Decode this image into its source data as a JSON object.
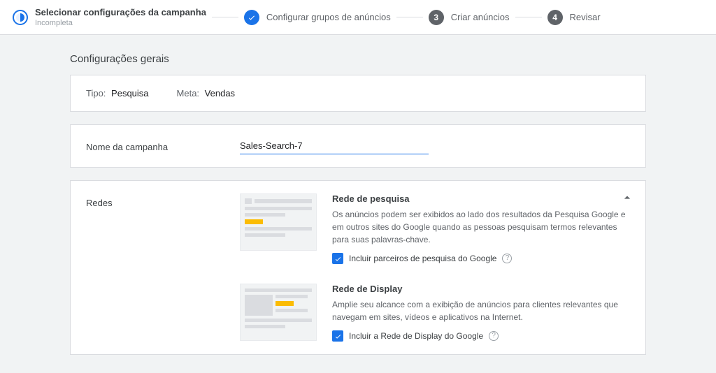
{
  "stepper": {
    "step1": {
      "title": "Selecionar configurações da campanha",
      "sub": "Incompleta"
    },
    "step2": {
      "title": "Configurar grupos de anúncios"
    },
    "step3": {
      "num": "3",
      "title": "Criar anúncios"
    },
    "step4": {
      "num": "4",
      "title": "Revisar"
    }
  },
  "page_title": "Configurações gerais",
  "summary": {
    "type_label": "Tipo:",
    "type_value": "Pesquisa",
    "goal_label": "Meta:",
    "goal_value": "Vendas"
  },
  "campaign_name": {
    "label": "Nome da campanha",
    "value": "Sales-Search-7"
  },
  "networks": {
    "section_label": "Redes",
    "search": {
      "title": "Rede de pesquisa",
      "desc": "Os anúncios podem ser exibidos ao lado dos resultados da Pesquisa Google e em outros sites do Google quando as pessoas pesquisam termos relevantes para suas palavras-chave.",
      "checkbox_label": "Incluir parceiros de pesquisa do Google"
    },
    "display": {
      "title": "Rede de Display",
      "desc": "Amplie seu alcance com a exibição de anúncios para clientes relevantes que navegam em sites, vídeos e aplicativos na Internet.",
      "checkbox_label": "Incluir a Rede de Display do Google"
    }
  }
}
